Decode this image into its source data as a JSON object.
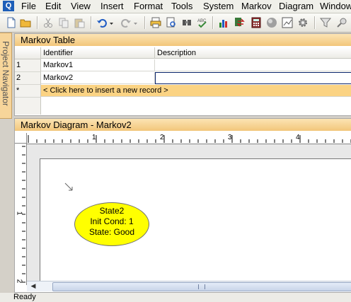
{
  "menu": [
    "File",
    "Edit",
    "View",
    "Insert",
    "Format",
    "Tools",
    "System",
    "Markov",
    "Diagram",
    "Window"
  ],
  "app_icon_letter": "Q",
  "side_tab": {
    "label": "Project Navigator"
  },
  "table": {
    "title": "Markov Table",
    "headers": [
      "Identifier",
      "Description"
    ],
    "rows": [
      {
        "num": "1",
        "identifier": "Markov1",
        "description": ""
      },
      {
        "num": "2",
        "identifier": "Markov2",
        "description": ""
      }
    ],
    "new_row": {
      "marker": "*",
      "text": "< Click here to insert a new record >"
    }
  },
  "diagram": {
    "title": "Markov Diagram - Markov2",
    "ruler_h_labels": [
      "1",
      "2",
      "3",
      "4"
    ],
    "ruler_v_labels": [
      "1",
      "2"
    ],
    "state": {
      "name": "State2",
      "init_cond": "Init Cond: 1",
      "state_label": "State: Good",
      "fill": "#ffff00"
    }
  },
  "status": {
    "text": "Ready"
  },
  "colors": {
    "panel_title": "#f2c67a",
    "new_record_row": "#fbd383",
    "selection": "#0a246a"
  }
}
